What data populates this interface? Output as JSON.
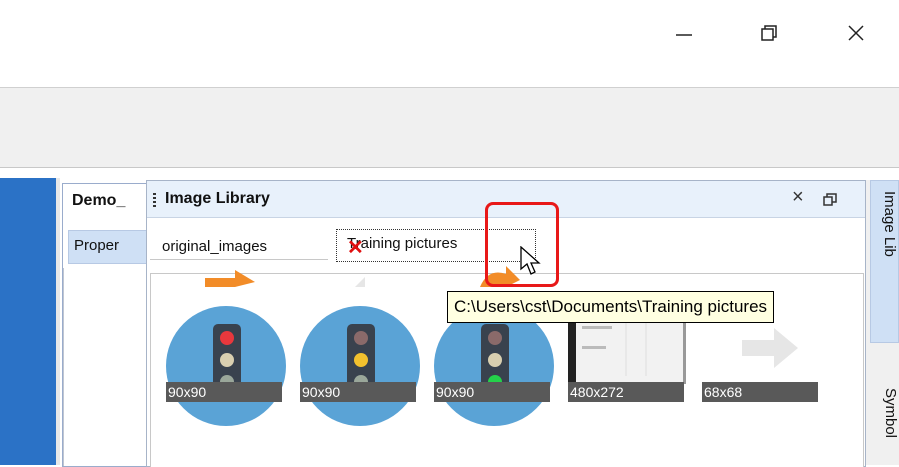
{
  "window": {
    "minimize_icon": "minimize-icon",
    "restore_icon": "restore-icon",
    "close_icon": "close-icon"
  },
  "demo_panel": {
    "title": "Demo_",
    "tab_label": "Proper"
  },
  "image_library": {
    "title": "Image Library",
    "close_glyph": "×",
    "tabs": [
      {
        "label": "original_images"
      },
      {
        "label": "Training pictures"
      }
    ],
    "tab_close_glyph": "✕",
    "thumbnails": [
      {
        "kind": "traffic-light",
        "active": "red",
        "size": "90x90"
      },
      {
        "kind": "traffic-light",
        "active": "yellow",
        "size": "90x90"
      },
      {
        "kind": "traffic-light",
        "active": "green",
        "size": "90x90"
      },
      {
        "kind": "display",
        "size": "480x272"
      },
      {
        "kind": "arrow",
        "size": "68x68"
      }
    ],
    "tooltip": "C:\\Users\\cst\\Documents\\Training pictures"
  },
  "side_tabs": [
    {
      "label": "Image Lib"
    },
    {
      "label": "Symbol"
    }
  ],
  "colors": {
    "accent_blue": "#2b72c6",
    "highlight_red": "#e81818",
    "tab_close_red": "#e01010",
    "tooltip_bg": "#ffffe1"
  }
}
